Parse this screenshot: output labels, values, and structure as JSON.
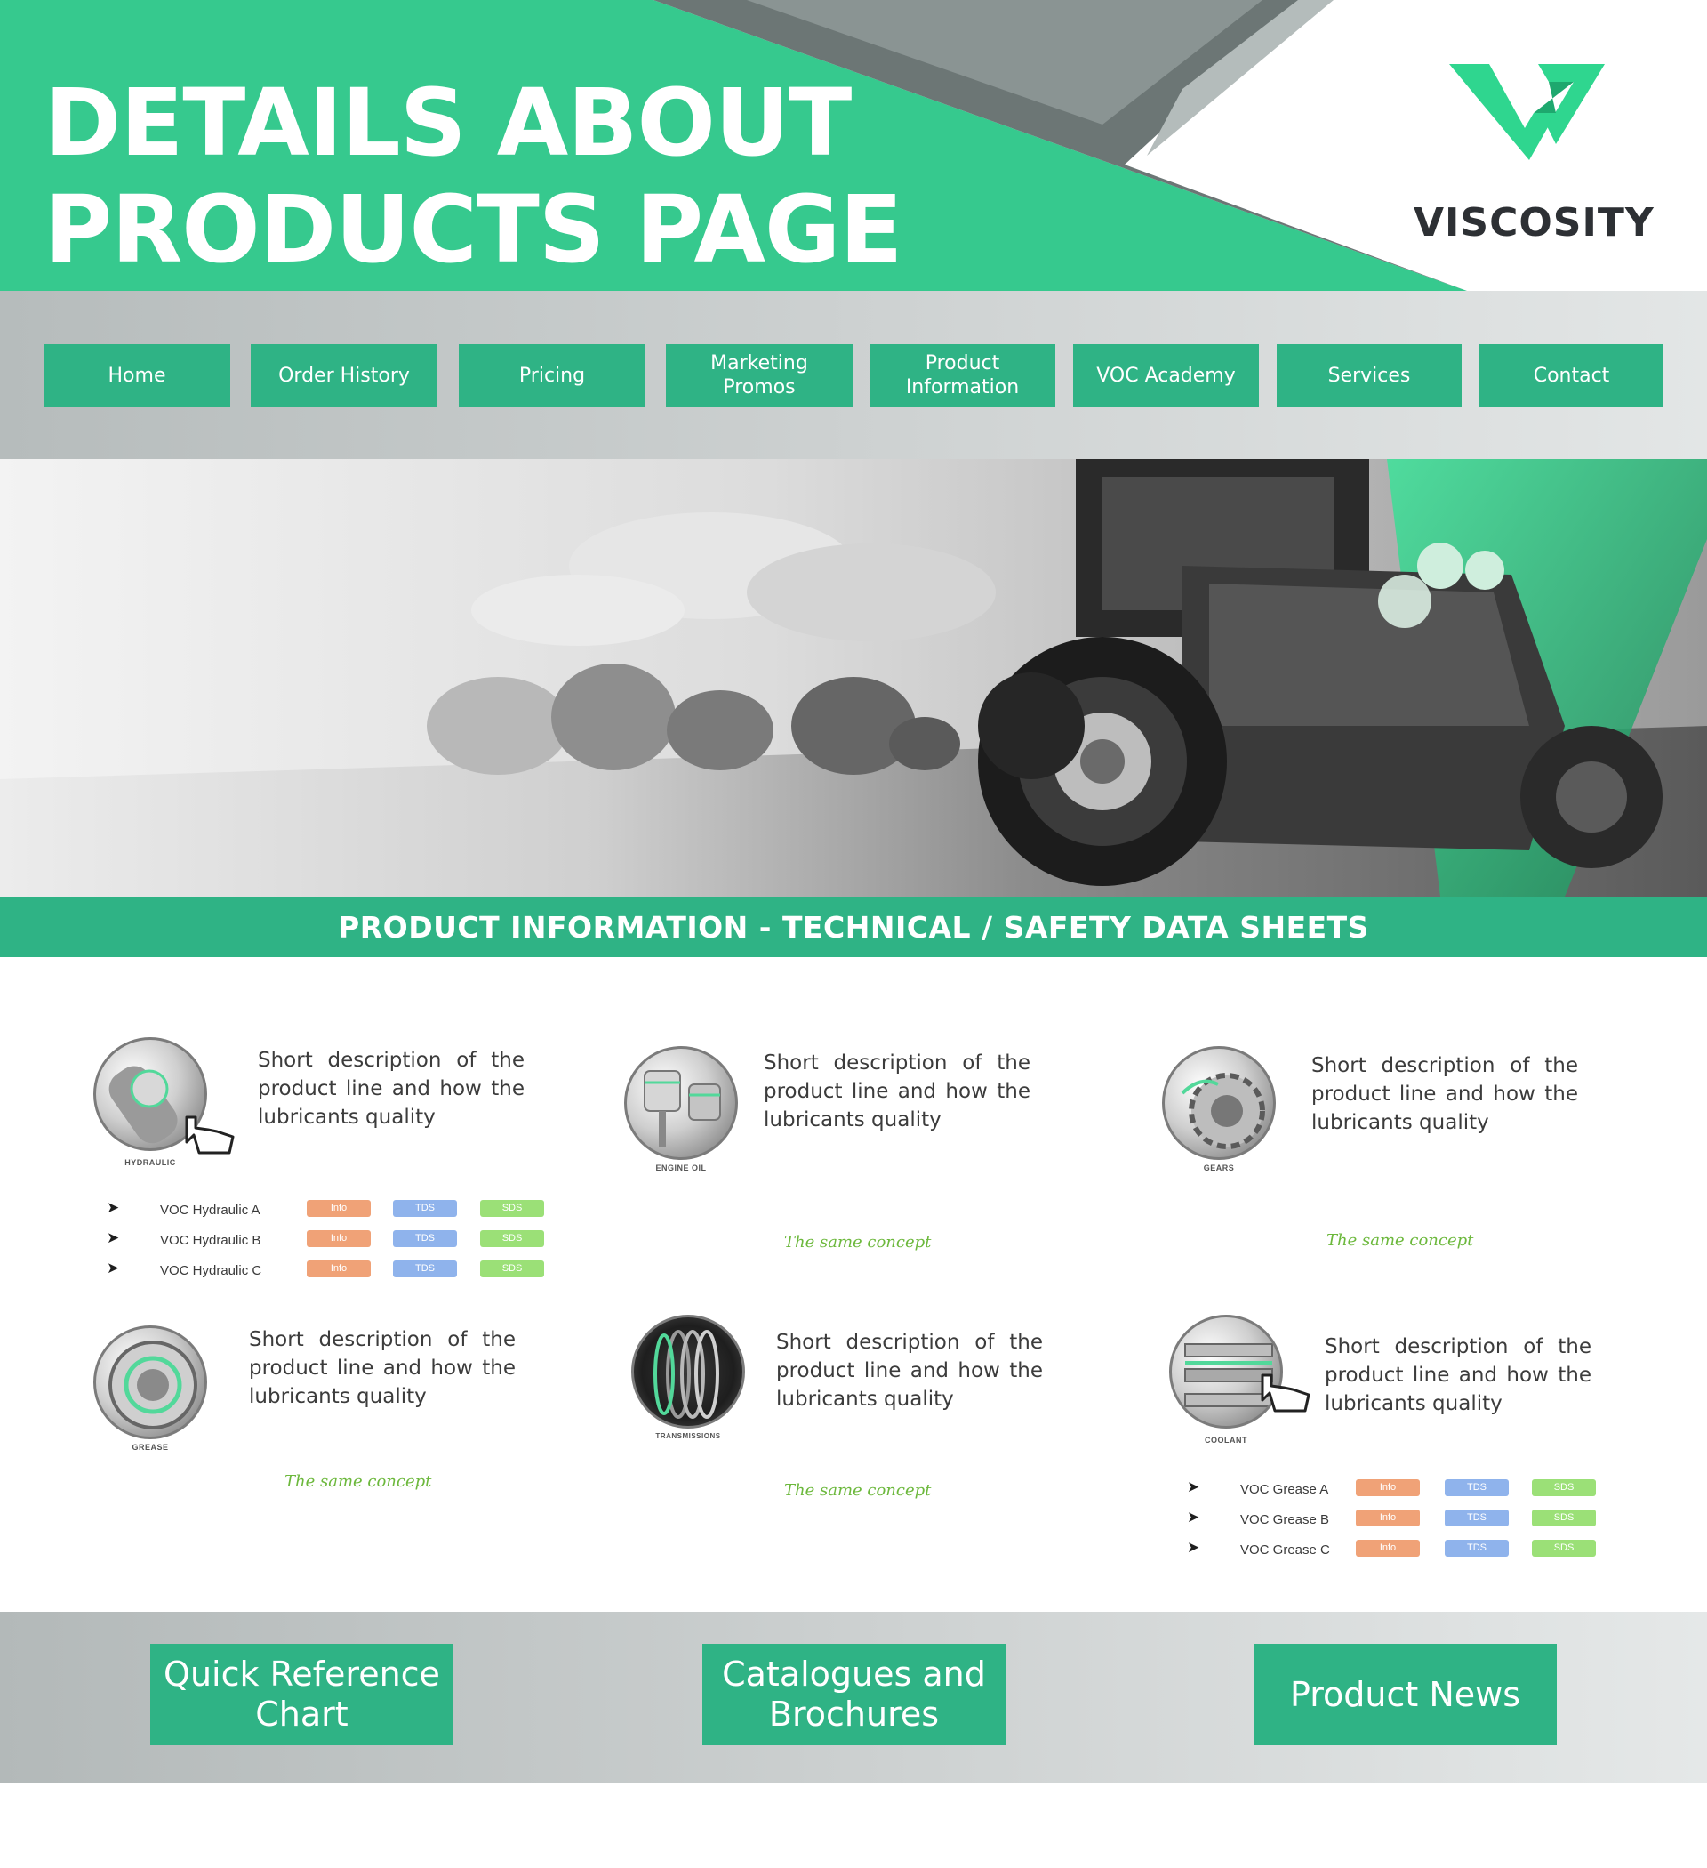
{
  "header": {
    "title": "DETAILS ABOUT\nPRODUCTS PAGE",
    "brand": "VISCOSITY",
    "colors": {
      "primary_green": "#36c98e",
      "dark_gray": "#6c7675",
      "accent": "#2fb385"
    }
  },
  "nav": {
    "items": [
      {
        "label": "Home"
      },
      {
        "label": "Order History"
      },
      {
        "label": "Pricing"
      },
      {
        "label": "Marketing\nPromos"
      },
      {
        "label": "Product\nInformation"
      },
      {
        "label": "VOC Academy"
      },
      {
        "label": "Services"
      },
      {
        "label": "Contact"
      }
    ]
  },
  "hero": {
    "image": "tractor-field-photo"
  },
  "section": {
    "title": "PRODUCT INFORMATION - TECHNICAL / SAFETY DATA SHEETS"
  },
  "cards": [
    {
      "icon": "hydraulic-icon",
      "label": "HYDRAULIC",
      "description": "Short description of the product line and how the lubricants quality",
      "products": [
        {
          "name": "VOC Hydraulic A",
          "tags": [
            "Info",
            "TDS",
            "SDS"
          ]
        },
        {
          "name": "VOC Hydraulic B",
          "tags": [
            "Info",
            "TDS",
            "SDS"
          ]
        },
        {
          "name": "VOC Hydraulic C",
          "tags": [
            "Info",
            "TDS",
            "SDS"
          ]
        }
      ]
    },
    {
      "icon": "engine-oil-icon",
      "label": "ENGINE OIL",
      "description": "Short description of the product line and how the lubricants quality",
      "note": "The same concept"
    },
    {
      "icon": "gears-icon",
      "label": "GEARS",
      "description": "Short description of the product line and how the lubricants quality",
      "note": "The same concept"
    },
    {
      "icon": "grease-icon",
      "label": "GREASE",
      "description": "Short description of the product line and how the lubricants quality",
      "note": "The same concept"
    },
    {
      "icon": "transmissions-icon",
      "label": "TRANSMISSIONS",
      "description": "Short description of the product line and how the lubricants quality",
      "note": "The same concept"
    },
    {
      "icon": "coolant-icon",
      "label": "COOLANT",
      "description": "Short description of the product line and how the lubricants quality",
      "products": [
        {
          "name": "VOC Grease A",
          "tags": [
            "Info",
            "TDS",
            "SDS"
          ]
        },
        {
          "name": "VOC Grease B",
          "tags": [
            "Info",
            "TDS",
            "SDS"
          ]
        },
        {
          "name": "VOC Grease C",
          "tags": [
            "Info",
            "TDS",
            "SDS"
          ]
        }
      ]
    }
  ],
  "tag_colors": {
    "Info": "#f0a277",
    "TDS": "#8fb3ec",
    "SDS": "#9be077"
  },
  "bottom": {
    "buttons": [
      {
        "label": "Quick Reference\nChart"
      },
      {
        "label": "Catalogues and\nBrochures"
      },
      {
        "label": "Product News"
      }
    ]
  }
}
